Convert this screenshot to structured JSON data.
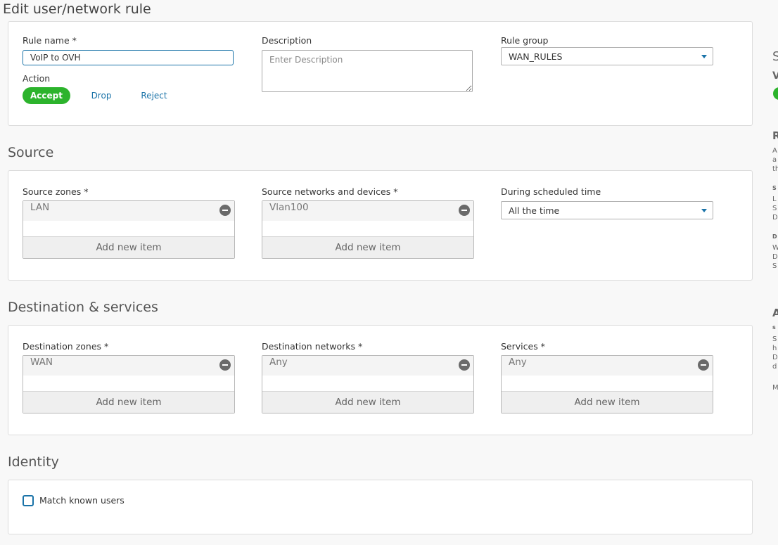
{
  "page_title": "Edit user/network rule",
  "general": {
    "rule_name_label": "Rule name *",
    "rule_name_value": "VoIP to OVH",
    "description_label": "Description",
    "description_placeholder": "Enter Description",
    "rule_group_label": "Rule group",
    "rule_group_value": "WAN_RULES",
    "action_label": "Action",
    "actions": [
      "Accept",
      "Drop",
      "Reject"
    ]
  },
  "source": {
    "heading": "Source",
    "zones_label": "Source zones *",
    "zones_item": "LAN",
    "networks_label": "Source networks and devices *",
    "networks_item": "Vlan100",
    "schedule_label": "During scheduled time",
    "schedule_value": "All the time"
  },
  "destination": {
    "heading": "Destination & services",
    "zones_label": "Destination zones *",
    "zones_item": "WAN",
    "networks_label": "Destination networks *",
    "networks_item": "Any",
    "services_label": "Services *",
    "services_item": "Any"
  },
  "add_new_item": "Add new item",
  "identity": {
    "heading": "Identity",
    "match_known_users_label": "Match known users"
  },
  "side_panel": {
    "s1": "S",
    "v": "V",
    "r": "R",
    "r_lines": [
      "A",
      "a",
      "th"
    ],
    "s_sub": "S",
    "s_lines": [
      "L",
      "S",
      "D"
    ],
    "d_sub": "D",
    "d_lines": [
      "W",
      "D",
      "S"
    ],
    "a": "A",
    "a_sub": "s",
    "a_lines": [
      "S",
      "h",
      "D",
      "d"
    ],
    "m": "M"
  },
  "colors": {
    "accent": "#1a73a8",
    "accept_green": "#2cb32c",
    "panel_border": "#dcdcdc",
    "background": "#f8f8f8"
  }
}
